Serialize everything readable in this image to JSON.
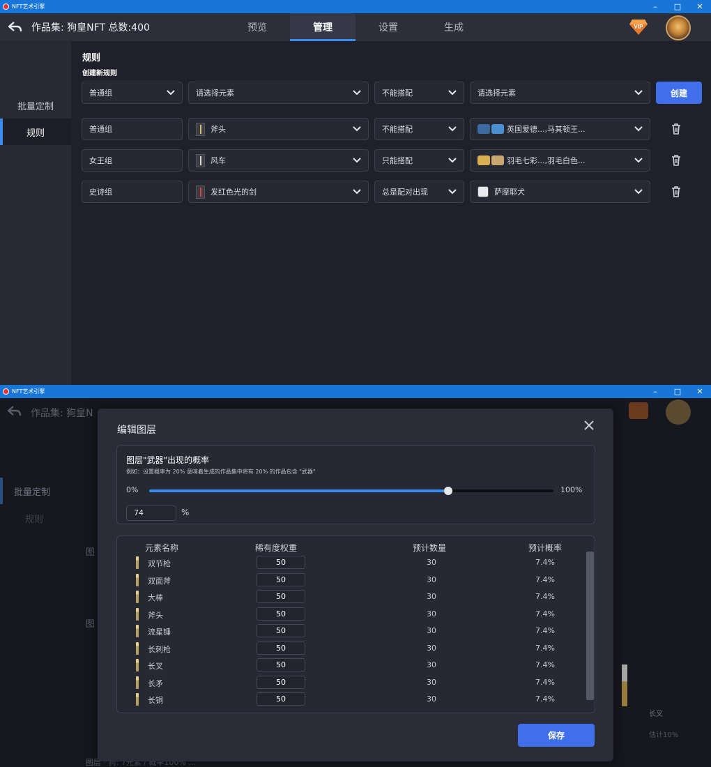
{
  "app": {
    "window_title": "NFT艺术引擎"
  },
  "header": {
    "collection": "作品集: 狗皇NFT 总数:400",
    "tabs": [
      "预览",
      "管理",
      "设置",
      "生成"
    ],
    "active_tab": 1
  },
  "sidebar": {
    "items": [
      "批量定制",
      "规则"
    ],
    "active": 1
  },
  "rules": {
    "title": "规则",
    "create_title": "创建新规则",
    "new_rule": {
      "group": "普通组",
      "element_a_placeholder": "请选择元素",
      "relation": "不能搭配",
      "element_b_placeholder": "请选择元素",
      "create_button": "创建"
    },
    "list": [
      {
        "group": "普通组",
        "element": "斧头",
        "relation": "不能搭配",
        "targets": "英国爱德...,马其顿王..."
      },
      {
        "group": "女王组",
        "element": "风车",
        "relation": "只能搭配",
        "targets": "羽毛七彩...,羽毛白色..."
      },
      {
        "group": "史诗组",
        "element": "发红色光的剑",
        "relation": "总是配对出现",
        "targets": "萨摩耶犬"
      }
    ]
  },
  "background": {
    "collection_partial": "作品集: 狗皇N",
    "sidebar_item": "批量定制",
    "sidebar_item2": "规则",
    "label1": "图",
    "label2": "图",
    "bottom_text": "图层 · 狗: 7元素 / 概率100%  ...",
    "right_label": "长叉",
    "right_sub": "估计10%"
  },
  "modal": {
    "title": "编辑图层",
    "probability_title": "图层\"武器\"出现的概率",
    "probability_desc": "例如：设置概率为 20% 意味着生成的作品集中将有 20% 的作品包含 \"武器\"",
    "slider_min": "0%",
    "slider_max": "100%",
    "probability_value": 74,
    "probability_input": "74",
    "percent_sign": "%",
    "table_headers": [
      "元素名称",
      "稀有度权重",
      "预计数量",
      "预计概率"
    ],
    "rows": [
      {
        "name": "双节枪",
        "weight": "50",
        "count": "30",
        "prob": "7.4%"
      },
      {
        "name": "双面斧",
        "weight": "50",
        "count": "30",
        "prob": "7.4%"
      },
      {
        "name": "大棒",
        "weight": "50",
        "count": "30",
        "prob": "7.4%"
      },
      {
        "name": "斧头",
        "weight": "50",
        "count": "30",
        "prob": "7.4%"
      },
      {
        "name": "流星锤",
        "weight": "50",
        "count": "30",
        "prob": "7.4%"
      },
      {
        "name": "长刺枪",
        "weight": "50",
        "count": "30",
        "prob": "7.4%"
      },
      {
        "name": "长叉",
        "weight": "50",
        "count": "30",
        "prob": "7.4%"
      },
      {
        "name": "长矛",
        "weight": "50",
        "count": "30",
        "prob": "7.4%"
      },
      {
        "name": "长铜",
        "weight": "50",
        "count": "30",
        "prob": "7.4%"
      }
    ],
    "save_button": "保存"
  },
  "colors": {
    "accent": "#3a8cf0",
    "button": "#3f6fea",
    "titlebar": "#1876d9"
  }
}
